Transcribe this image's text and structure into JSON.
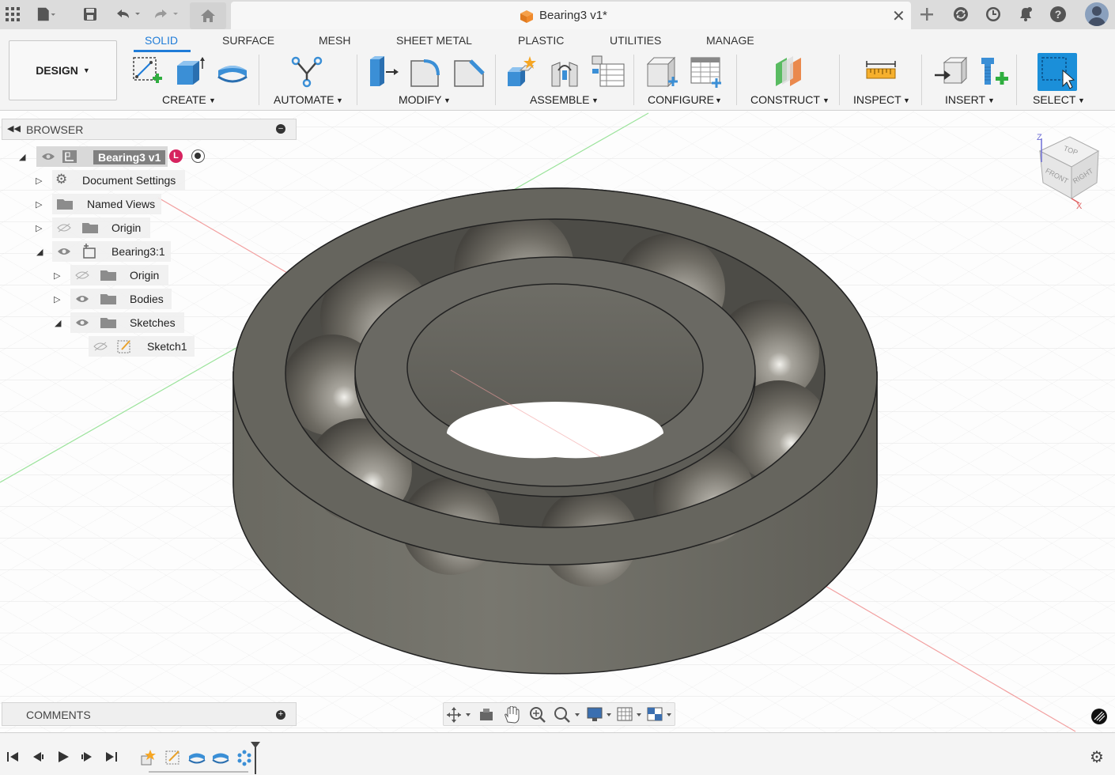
{
  "window": {
    "document_title": "Bearing3 v1*"
  },
  "ribbon": {
    "workspace_label": "DESIGN",
    "tabs": [
      "SOLID",
      "SURFACE",
      "MESH",
      "SHEET METAL",
      "PLASTIC",
      "UTILITIES",
      "MANAGE"
    ],
    "active_tab": "SOLID",
    "groups": [
      "CREATE",
      "AUTOMATE",
      "MODIFY",
      "ASSEMBLE",
      "CONFIGURE",
      "CONSTRUCT",
      "INSPECT",
      "INSERT",
      "SELECT"
    ]
  },
  "browser": {
    "title": "BROWSER",
    "root": "Bearing3 v1",
    "items": [
      {
        "label": "Document Settings"
      },
      {
        "label": "Named Views"
      },
      {
        "label": "Origin"
      },
      {
        "label": "Bearing3:1"
      },
      {
        "label": "Origin"
      },
      {
        "label": "Bodies"
      },
      {
        "label": "Sketches"
      },
      {
        "label": "Sketch1"
      }
    ]
  },
  "viewcube": {
    "top": "TOP",
    "front": "FRONT",
    "right": "RIGHT",
    "axis_z": "Z",
    "axis_x": "X"
  },
  "comments": {
    "title": "COMMENTS"
  },
  "colors": {
    "accent": "#1f7cd8",
    "bearing_body": "#6b6a63",
    "grid_line": "#e3e3e3"
  }
}
